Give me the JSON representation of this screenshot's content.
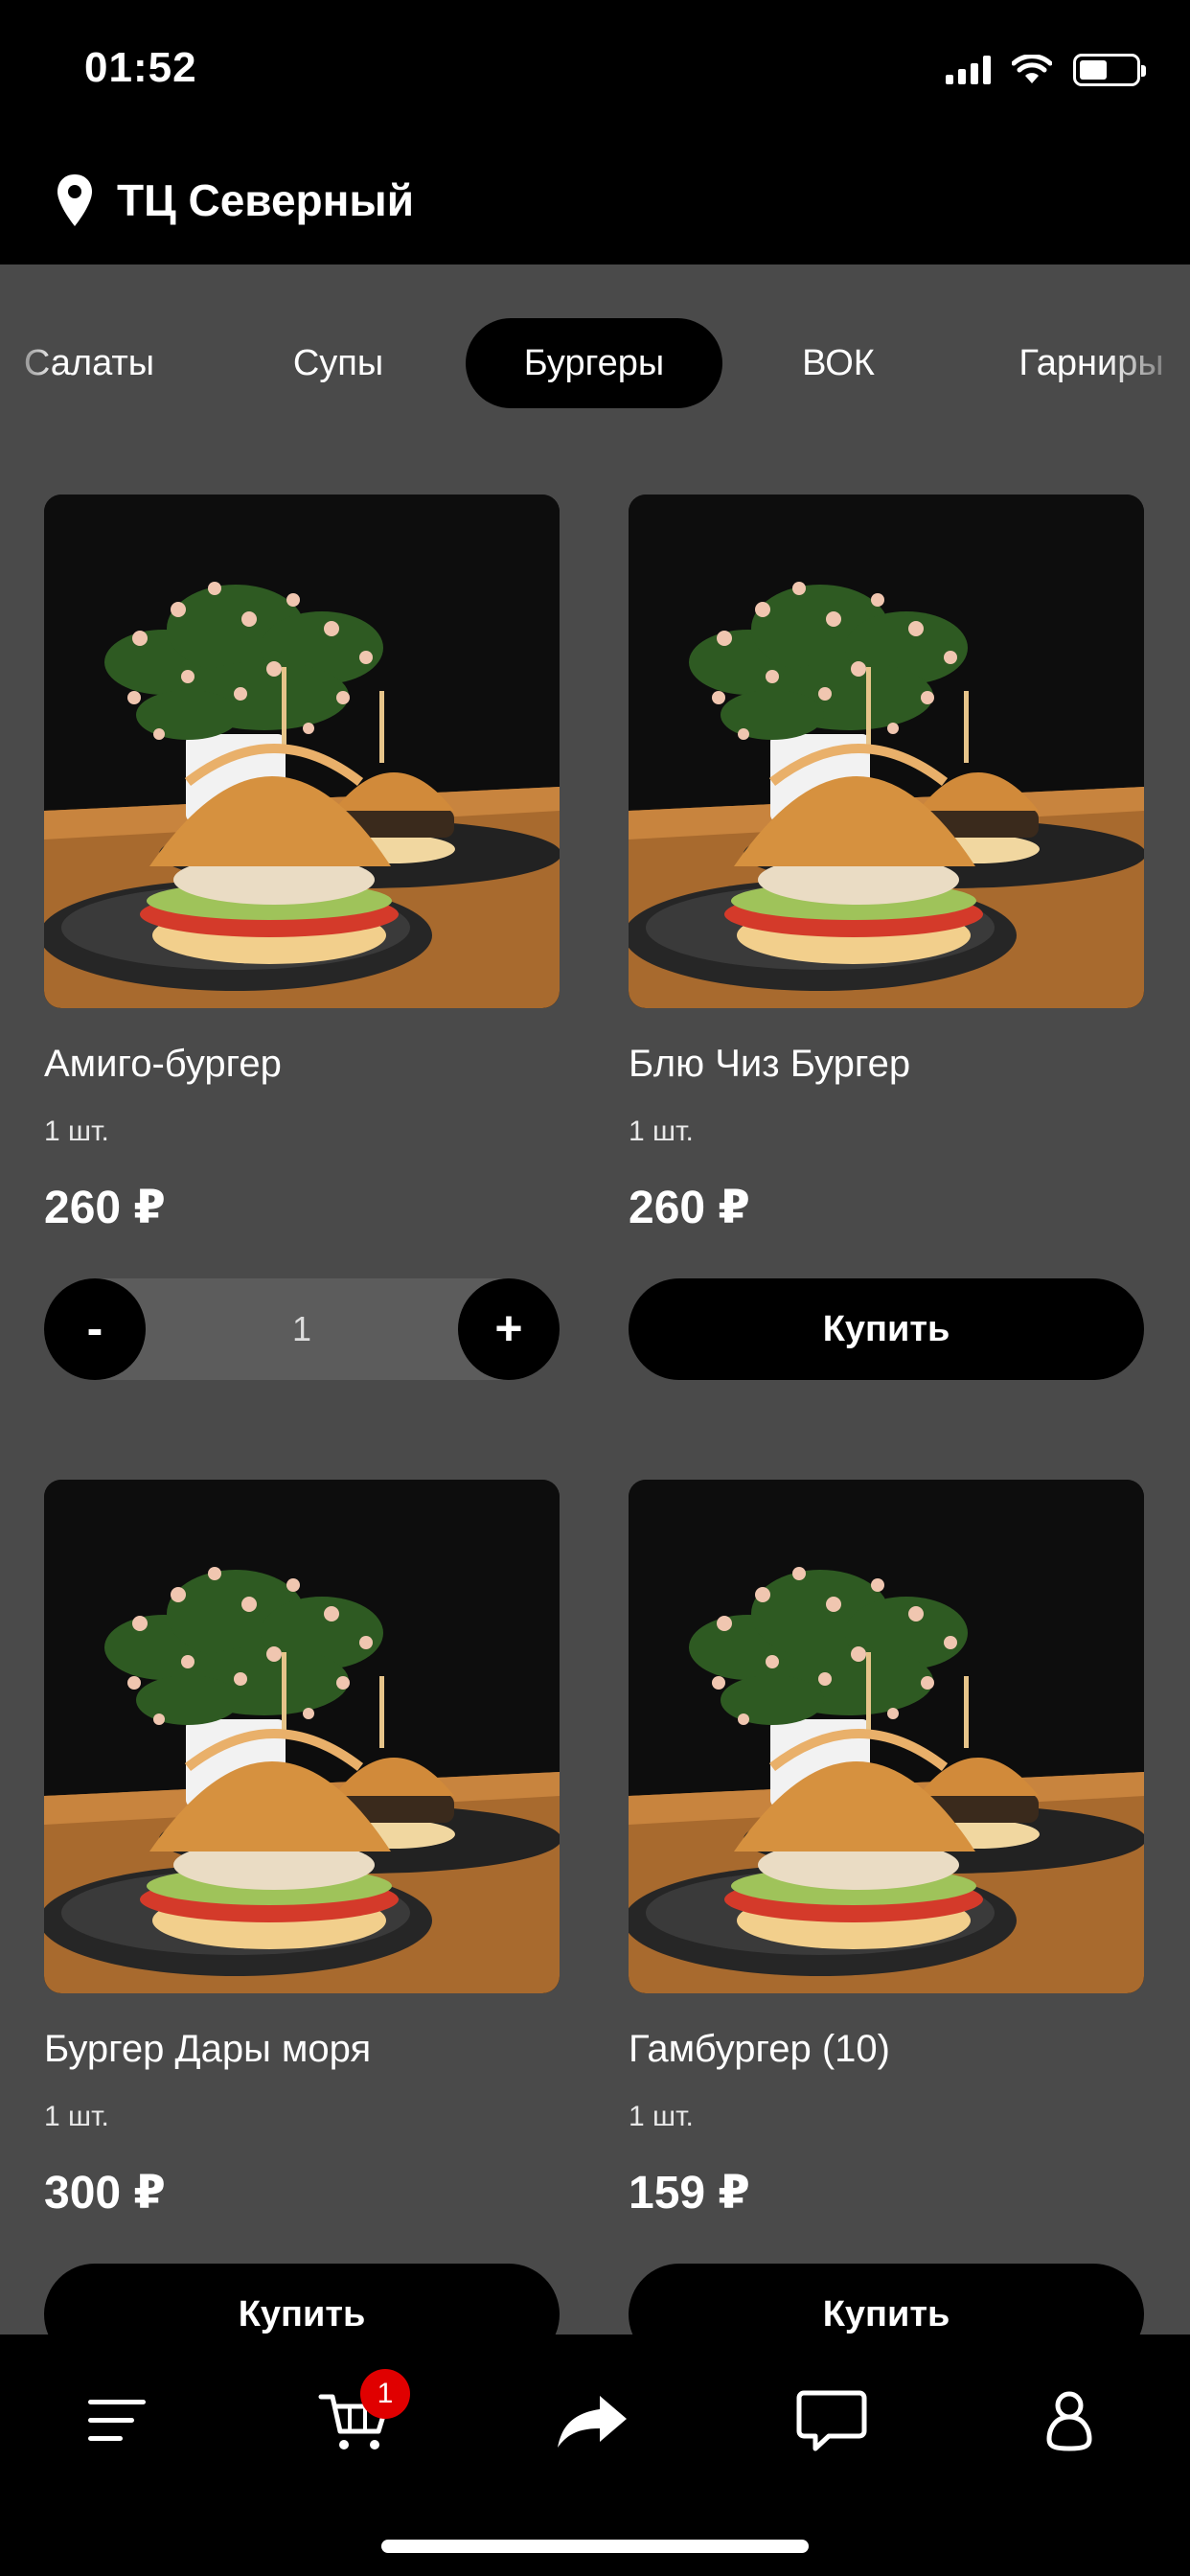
{
  "status": {
    "time": "01:52"
  },
  "header": {
    "location": "ТЦ Северный"
  },
  "categories": [
    {
      "label": "Салаты",
      "active": false
    },
    {
      "label": "Супы",
      "active": false
    },
    {
      "label": "Бургеры",
      "active": true
    },
    {
      "label": "ВОК",
      "active": false
    },
    {
      "label": "Гарниры",
      "active": false
    }
  ],
  "products": [
    {
      "name": "Амиго-бургер",
      "qty": "1 шт.",
      "price": "260 ₽",
      "in_cart": 1,
      "minus_label": "-",
      "plus_label": "+"
    },
    {
      "name": "Блю Чиз Бургер",
      "qty": "1 шт.",
      "price": "260 ₽",
      "buy_label": "Купить"
    },
    {
      "name": "Бургер Дары моря",
      "qty": "1 шт.",
      "price": "300 ₽",
      "buy_label": "Купить"
    },
    {
      "name": "Гамбургер (10)",
      "qty": "1 шт.",
      "price": "159 ₽",
      "buy_label": "Купить"
    }
  ],
  "bottom_nav": {
    "items": [
      "menu-icon",
      "cart-icon",
      "share-icon",
      "chat-icon",
      "profile-icon"
    ],
    "cart_badge": "1"
  },
  "colors": {
    "background": "#4a4a4a",
    "bar": "#000000",
    "badge": "#e00000"
  }
}
